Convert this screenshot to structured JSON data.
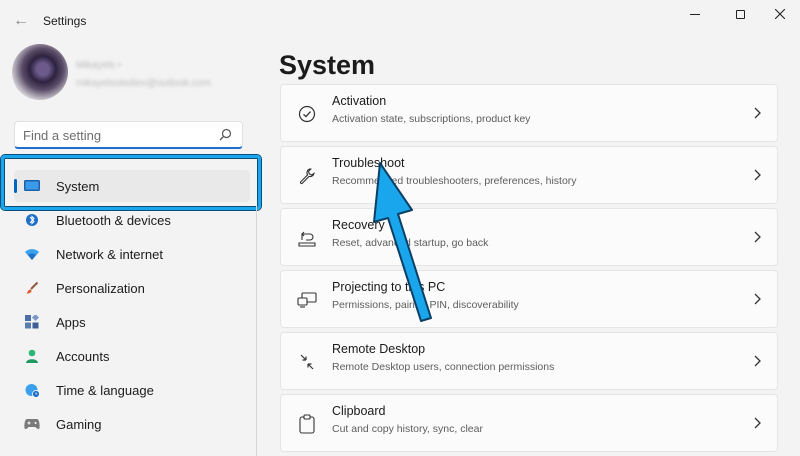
{
  "window": {
    "title": "Settings",
    "back_icon": "back-arrow-icon"
  },
  "profile": {
    "name": "Mikayels •",
    "email": "mikayelsoboliev@outlook.com"
  },
  "search": {
    "placeholder": "Find a setting",
    "icon": "search-icon"
  },
  "nav": {
    "items": [
      {
        "label": "System",
        "icon": "system-icon",
        "selected": true
      },
      {
        "label": "Bluetooth & devices",
        "icon": "bluetooth-icon"
      },
      {
        "label": "Network & internet",
        "icon": "network-icon"
      },
      {
        "label": "Personalization",
        "icon": "brush-icon"
      },
      {
        "label": "Apps",
        "icon": "apps-icon"
      },
      {
        "label": "Accounts",
        "icon": "person-icon"
      },
      {
        "label": "Time & language",
        "icon": "globe-clock-icon"
      },
      {
        "label": "Gaming",
        "icon": "gamepad-icon"
      }
    ]
  },
  "page": {
    "title": "System"
  },
  "cards": [
    {
      "title": "Activation",
      "subtitle": "Activation state, subscriptions, product key",
      "icon": "check-circle-icon"
    },
    {
      "title": "Troubleshoot",
      "subtitle": "Recommended troubleshooters, preferences, history",
      "icon": "wrench-icon"
    },
    {
      "title": "Recovery",
      "subtitle": "Reset, advanced startup, go back",
      "icon": "recovery-icon"
    },
    {
      "title": "Projecting to this PC",
      "subtitle": "Permissions, pairing PIN, discoverability",
      "icon": "projector-icon"
    },
    {
      "title": "Remote Desktop",
      "subtitle": "Remote Desktop users, connection permissions",
      "icon": "remote-desktop-icon"
    },
    {
      "title": "Clipboard",
      "subtitle": "Cut and copy history, sync, clear",
      "icon": "clipboard-icon"
    }
  ],
  "colors": {
    "accent": "#0067c0",
    "annotation": "#1aa6ec"
  }
}
